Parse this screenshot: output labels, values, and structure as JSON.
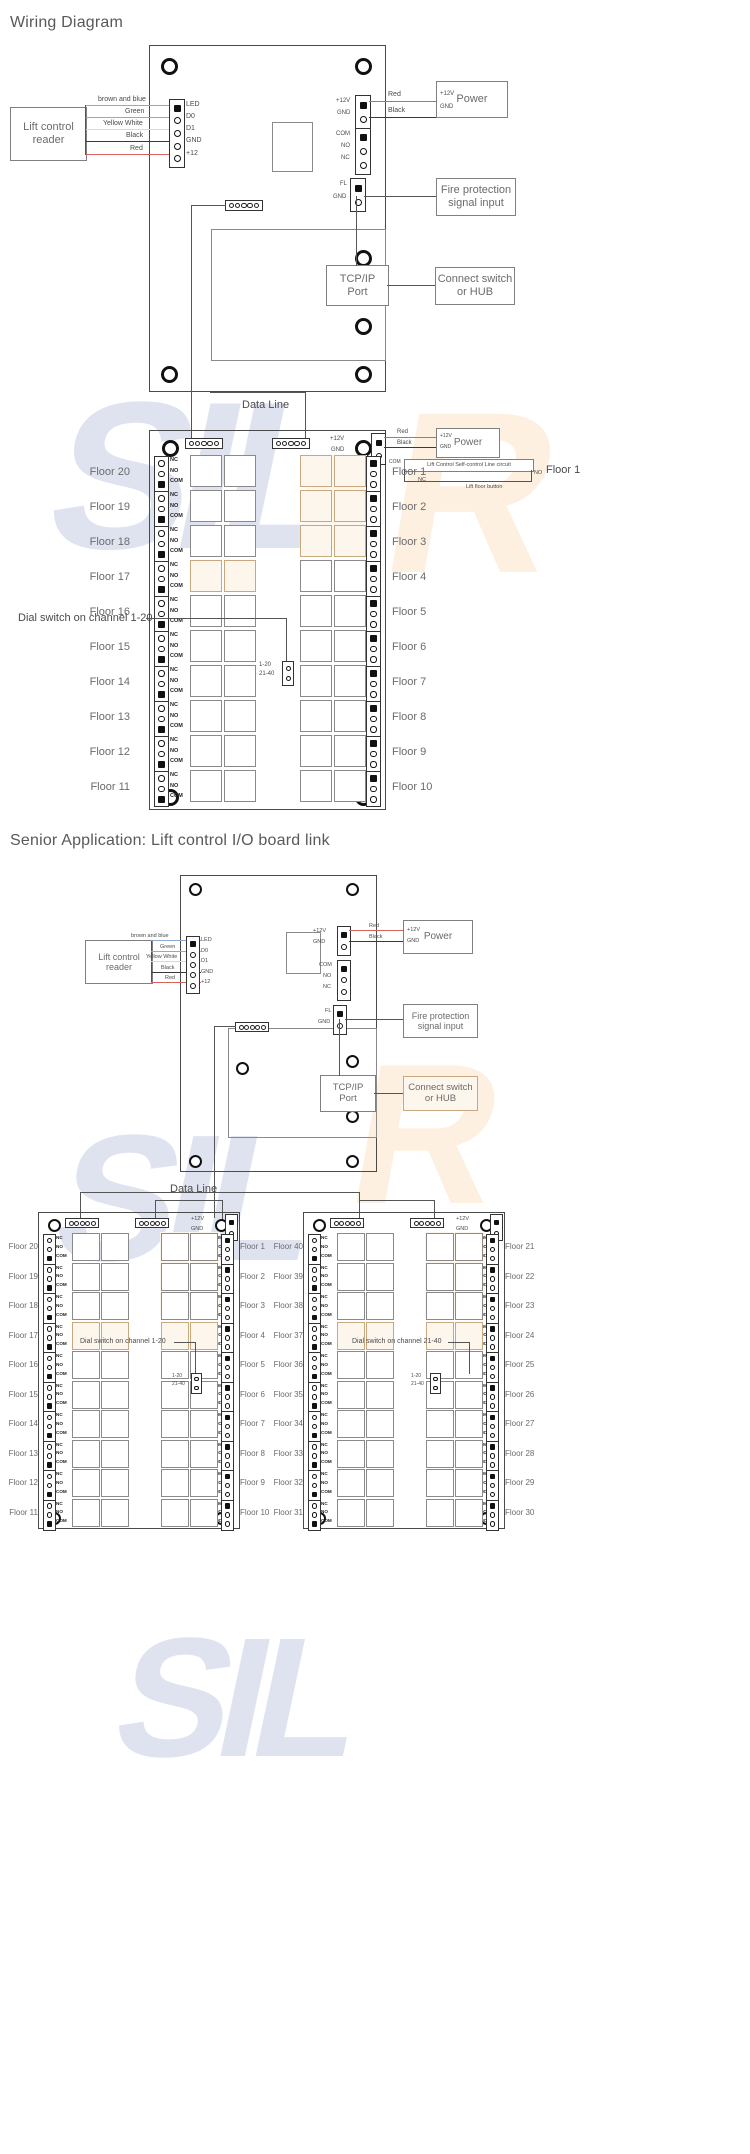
{
  "sections": [
    {
      "id": "s1",
      "title": "Wiring Diagram"
    },
    {
      "id": "s2",
      "title": "Senior Application: Lift control I/O board link"
    }
  ],
  "watermark": {
    "text_blue": "SIL",
    "text_orange": "R"
  },
  "reader": {
    "label_line1": "Lift control",
    "label_line2": "reader",
    "wires": [
      {
        "color_name": "brown and blue",
        "pin": "LED",
        "hex": "#8aa9d4"
      },
      {
        "color_name": "Green",
        "pin": "D0",
        "hex": "#7fc08a"
      },
      {
        "color_name": "Yellow White",
        "pin": "D1",
        "hex": "#e8e08a"
      },
      {
        "color_name": "Black",
        "pin": "GND",
        "hex": "#3a3a3a"
      },
      {
        "color_name": "Red",
        "pin": "+12",
        "hex": "#d4635b"
      }
    ]
  },
  "power": {
    "title": "Power",
    "pin_pos": "+12V",
    "pin_gnd": "GND",
    "wire_pos": "Red",
    "wire_neg": "Black",
    "board_pin_pos": "+12V",
    "board_pin_gnd": "GND"
  },
  "relay_out": {
    "com": "COM",
    "no": "NO",
    "nc": "NC"
  },
  "fire": {
    "pin_fl": "FL",
    "pin_gnd": "GND",
    "box_line1": "Fire protection",
    "box_line2": "signal input"
  },
  "tcpip": {
    "port_line1": "TCP/IP",
    "port_line2": "Port",
    "switch_line1": "Connect switch",
    "switch_line2": "or HUB"
  },
  "data_line_label": "Data Line",
  "io_board": {
    "terminal_labels_left": [
      "NC",
      "NO",
      "COM"
    ],
    "terminal_labels_right": [
      "COM",
      "NO",
      "NC"
    ],
    "left_floors": [
      "Floor 20",
      "Floor 19",
      "Floor 18",
      "Floor 17",
      "Floor 16",
      "Floor 15",
      "Floor 14",
      "Floor 13",
      "Floor 12",
      "Floor 11"
    ],
    "right_floors": [
      "Floor 1",
      "Floor 2",
      "Floor 3",
      "Floor 4",
      "Floor 5",
      "Floor 6",
      "Floor 7",
      "Floor 8",
      "Floor 9",
      "Floor 10"
    ],
    "dial_switch_note": "Dial switch on channel 1-20",
    "dial_top": "1-20",
    "dial_bottom": "21-40",
    "self_control_line": "Lift Control Self-control Line circuit",
    "self_control_nc": "NC",
    "self_control_no": "NO",
    "lift_floor_button": "Lift floor button"
  },
  "senior": {
    "board_a": {
      "left_floors": [
        "Floor 20",
        "Floor 19",
        "Floor 18",
        "Floor 17",
        "Floor 16",
        "Floor 15",
        "Floor 14",
        "Floor 13",
        "Floor 12",
        "Floor 11"
      ],
      "right_floors": [
        "Floor 1",
        "Floor 2",
        "Floor 3",
        "Floor 4",
        "Floor 5",
        "Floor 6",
        "Floor 7",
        "Floor 8",
        "Floor 9",
        "Floor 10"
      ],
      "dial_switch_note": "Dial switch on channel 1-20",
      "dial_top": "1-20",
      "dial_bottom": "21-40"
    },
    "board_b": {
      "left_floors": [
        "Floor 40",
        "Floor 39",
        "Floor 38",
        "Floor 37",
        "Floor 36",
        "Floor 35",
        "Floor 34",
        "Floor 33",
        "Floor 32",
        "Floor 31"
      ],
      "right_floors": [
        "Floor 21",
        "Floor 22",
        "Floor 23",
        "Floor 24",
        "Floor 25",
        "Floor 26",
        "Floor 27",
        "Floor 28",
        "Floor 29",
        "Floor 30"
      ],
      "dial_switch_note": "Dial switch on channel 21-40",
      "dial_top": "1-20",
      "dial_bottom": "21-40"
    }
  },
  "colors": {
    "board_stroke": "#4a4a4a",
    "text": "#5a5a5a",
    "red_wire": "#d4635b",
    "black_wire": "#3a3a3a",
    "tan_fill": "#fdf6ec",
    "tan_stroke": "#c8a87e"
  }
}
